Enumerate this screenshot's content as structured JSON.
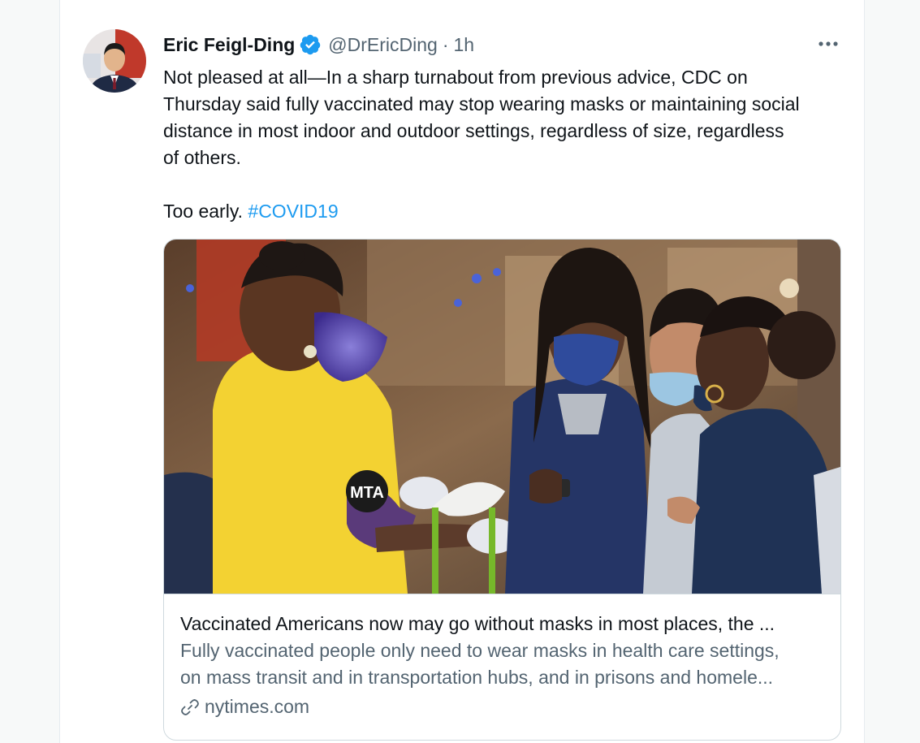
{
  "tweet": {
    "display_name": "Eric Feigl-Ding",
    "handle": "@DrEricDing",
    "separator": "·",
    "time": "1h",
    "text_line1": "Not pleased at all—In a sharp turnabout from previous advice, CDC on",
    "text_line2": "Thursday said fully vaccinated may stop wearing masks or maintaining social",
    "text_line3": "distance in most indoor and outdoor settings, regardless of size, regardless",
    "text_line4": "of others.",
    "text_second_para": "Too early.",
    "hashtag": "#COVID19"
  },
  "card": {
    "title": "Vaccinated Americans now may go without masks in most places, the ...",
    "description_line1": "Fully vaccinated people only need to wear masks in health care settings,",
    "description_line2": "on mass transit and in transportation hubs, and in prisons and homele...",
    "domain": "nytimes.com",
    "image_mask_logo": "MTA"
  },
  "colors": {
    "accent": "#1d9bf0",
    "text": "#0f1419",
    "secondary": "#536471",
    "border": "#cfd9de"
  },
  "icons": [
    "verified-badge-icon",
    "more-options-icon",
    "link-icon"
  ]
}
